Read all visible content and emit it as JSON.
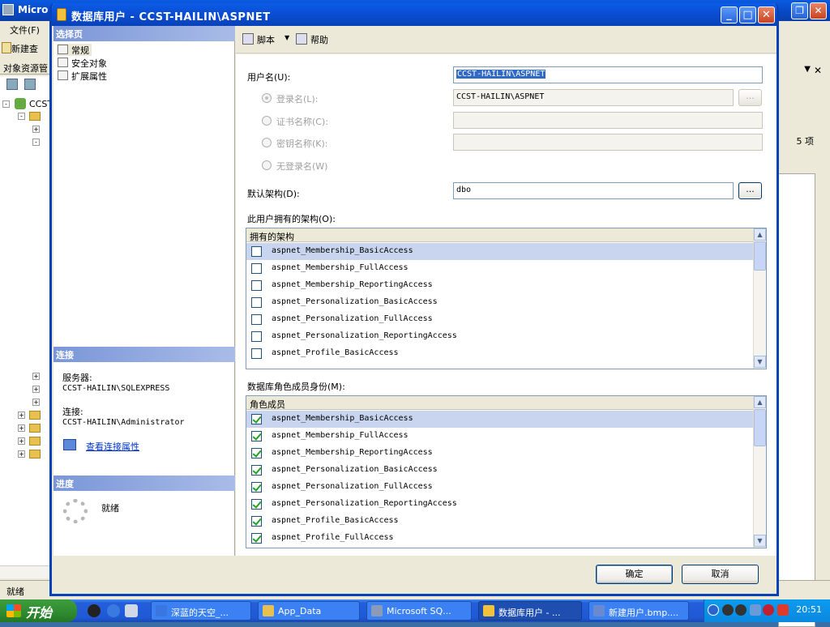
{
  "bg": {
    "title": "Micro",
    "menu": "文件(F)",
    "toolbar_btn": "新建查",
    "oe_title": "对象资源管",
    "server_node": "CCST",
    "right_items": "5 项",
    "status": "就绪"
  },
  "dialog": {
    "title": "数据库用户 - CCST-HAILIN\\ASPNET",
    "select_page_header": "选择页",
    "pages": [
      "常规",
      "安全对象",
      "扩展属性"
    ],
    "connection_header": "连接",
    "server_label": "服务器:",
    "server_value": "CCST-HAILIN\\SQLEXPRESS",
    "conn_label": "连接:",
    "conn_value": "CCST-HAILIN\\Administrator",
    "view_conn_props": "查看连接属性",
    "progress_header": "进度",
    "progress_status": "就绪",
    "script_label": "脚本",
    "help_label": "帮助",
    "username_label": "用户名(U):",
    "username_value": "CCST-HAILIN\\ASPNET",
    "login_name_label": "登录名(L):",
    "login_name_value": "CCST-HAILIN\\ASPNET",
    "cert_name_label": "证书名称(C):",
    "key_name_label": "密钥名称(K):",
    "no_login_label": "无登录名(W)",
    "default_schema_label": "默认架构(D):",
    "default_schema_value": "dbo",
    "dots": "...",
    "owned_schemas_label": "此用户拥有的架构(O):",
    "owned_schemas_header": "拥有的架构",
    "owned_schemas": [
      {
        "name": "aspnet_Membership_BasicAccess",
        "checked": false
      },
      {
        "name": "aspnet_Membership_FullAccess",
        "checked": false
      },
      {
        "name": "aspnet_Membership_ReportingAccess",
        "checked": false
      },
      {
        "name": "aspnet_Personalization_BasicAccess",
        "checked": false
      },
      {
        "name": "aspnet_Personalization_FullAccess",
        "checked": false
      },
      {
        "name": "aspnet_Personalization_ReportingAccess",
        "checked": false
      },
      {
        "name": "aspnet_Profile_BasicAccess",
        "checked": false
      }
    ],
    "roles_label": "数据库角色成员身份(M):",
    "roles_header": "角色成员",
    "roles": [
      {
        "name": "aspnet_Membership_BasicAccess",
        "checked": true
      },
      {
        "name": "aspnet_Membership_FullAccess",
        "checked": true
      },
      {
        "name": "aspnet_Membership_ReportingAccess",
        "checked": true
      },
      {
        "name": "aspnet_Personalization_BasicAccess",
        "checked": true
      },
      {
        "name": "aspnet_Personalization_FullAccess",
        "checked": true
      },
      {
        "name": "aspnet_Personalization_ReportingAccess",
        "checked": true
      },
      {
        "name": "aspnet_Profile_BasicAccess",
        "checked": true
      },
      {
        "name": "aspnet_Profile_FullAccess",
        "checked": true
      }
    ],
    "ok_label": "确定",
    "cancel_label": "取消"
  },
  "taskbar": {
    "start_label": "开始",
    "tasks": [
      {
        "label": "深蓝的天空_...",
        "color": "#3a76e0"
      },
      {
        "label": "App_Data",
        "color": "#e8c050"
      },
      {
        "label": "Microsoft SQ...",
        "color": "#8a9ab8"
      },
      {
        "label": "数据库用户 - ...",
        "color": "#f3c23c"
      },
      {
        "label": "新建用户.bmp....",
        "color": "#6a8ad0"
      }
    ],
    "clock": "20:51"
  },
  "colors": {
    "title_blue": "#0a5ce6",
    "check_green": "#21a121",
    "selected_row": "#c9d5ee"
  }
}
